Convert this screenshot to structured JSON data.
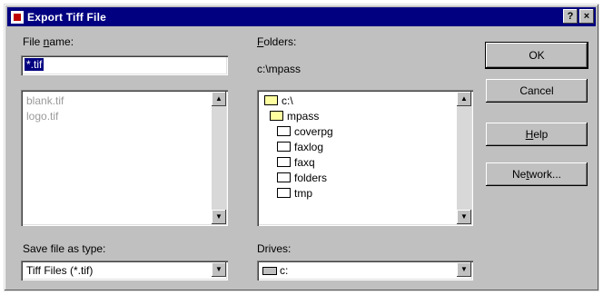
{
  "window": {
    "title": "Export Tiff File",
    "help_btn": "?",
    "close_btn": "×"
  },
  "file_name": {
    "label_prefix": "File ",
    "label_underline": "n",
    "label_suffix": "ame:",
    "value": "*.tif",
    "list_items": [
      "blank.tif",
      "logo.tif"
    ]
  },
  "folders": {
    "label_underline": "F",
    "label_suffix": "olders:",
    "current_path": "c:\\mpass",
    "items": [
      "c:\\",
      "mpass",
      "coverpg",
      "faxlog",
      "faxq",
      "folders",
      "tmp"
    ]
  },
  "save_as": {
    "label": "Save file as type:",
    "value": "Tiff Files (*.tif)"
  },
  "drives": {
    "label": "Drives:",
    "value": "c:"
  },
  "buttons": {
    "ok": "OK",
    "cancel": "Cancel",
    "help_prefix": "",
    "help_underline": "H",
    "help_suffix": "elp",
    "network_prefix": "Ne",
    "network_underline": "t",
    "network_suffix": "work..."
  },
  "icons": {
    "app": "app-icon",
    "folder": "folder-icon",
    "drive": "drive-icon",
    "scroll_up": "scroll-up-icon",
    "scroll_down": "scroll-down-icon",
    "combo_arrow": "chevron-down-icon"
  }
}
